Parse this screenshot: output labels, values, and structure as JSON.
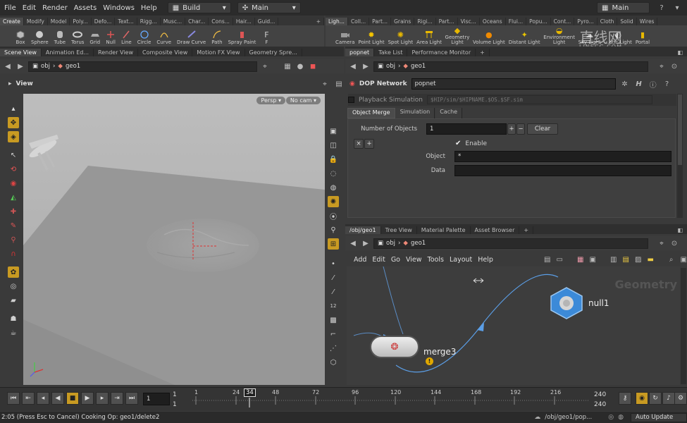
{
  "menu": [
    "File",
    "Edit",
    "Render",
    "Assets",
    "Windows",
    "Help"
  ],
  "desktop": "Build",
  "context": "Main",
  "context_right": "Main",
  "shelf_left": {
    "tabs": [
      "Create",
      "Modify",
      "Model",
      "Poly...",
      "Defo...",
      "Text...",
      "Rigg...",
      "Musc...",
      "Char...",
      "Cons...",
      "Hair...",
      "Guid..."
    ],
    "tools": [
      {
        "label": "Box",
        "icon": "cube-icon"
      },
      {
        "label": "Sphere",
        "icon": "sphere-icon"
      },
      {
        "label": "Tube",
        "icon": "tube-icon"
      },
      {
        "label": "Torus",
        "icon": "torus-icon"
      },
      {
        "label": "Grid",
        "icon": "grid-icon"
      },
      {
        "label": "Null",
        "icon": "null-icon"
      },
      {
        "label": "Line",
        "icon": "line-icon"
      },
      {
        "label": "Circle",
        "icon": "circle-icon"
      },
      {
        "label": "Curve",
        "icon": "curve-icon"
      },
      {
        "label": "Draw Curve",
        "icon": "draw-curve-icon"
      },
      {
        "label": "Path",
        "icon": "path-icon"
      },
      {
        "label": "Spray Paint",
        "icon": "spray-icon"
      },
      {
        "label": "F",
        "icon": "font-icon"
      }
    ]
  },
  "shelf_right": {
    "tabs": [
      "Ligh...",
      "Coll...",
      "Part...",
      "Grains",
      "Rigi...",
      "Part...",
      "Visc...",
      "Oceans",
      "Flui...",
      "Popu...",
      "Cont...",
      "Pyro...",
      "Cloth",
      "Solid",
      "Wires"
    ],
    "tools": [
      {
        "label": "Camera",
        "icon": "camera-icon"
      },
      {
        "label": "Point Light",
        "icon": "point-light-icon"
      },
      {
        "label": "Spot Light",
        "icon": "spot-light-icon"
      },
      {
        "label": "Area Light",
        "icon": "area-light-icon"
      },
      {
        "label": "Geometry Light",
        "icon": "geometry-light-icon"
      },
      {
        "label": "Volume Light",
        "icon": "volume-light-icon"
      },
      {
        "label": "Distant Light",
        "icon": "distant-light-icon"
      },
      {
        "label": "Environment Light",
        "icon": "environment-light-icon"
      },
      {
        "label": "Sky Light",
        "icon": "sky-light-icon"
      },
      {
        "label": "...atic Light",
        "icon": "caustic-light-icon"
      },
      {
        "label": "Portal",
        "icon": "portal-icon"
      }
    ]
  },
  "watermark": {
    "cn": "直线网",
    "en": "LINECG.COM"
  },
  "viewer": {
    "tabs": [
      "Scene View",
      "Animation Ed...",
      "Render View",
      "Composite View",
      "Motion FX View",
      "Geometry Spre..."
    ],
    "path": [
      "obj",
      "geo1"
    ],
    "title": "View",
    "persp": "Persp",
    "cam": "No cam"
  },
  "params": {
    "tabs": [
      "popnet",
      "Take List",
      "Performance Monitor"
    ],
    "path": [
      "obj",
      "geo1"
    ],
    "node_type": "DOP Network",
    "node_name": "popnet",
    "playback_label": "Playback Simulation",
    "file_path": "$HIP/sim/$HIPNAME.$OS.$SF.sim",
    "sub_tabs": [
      "Object Merge",
      "Simulation",
      "Cache"
    ],
    "num_objects_label": "Number of Objects",
    "num_objects": "1",
    "clear_label": "Clear",
    "enable_label": "Enable",
    "object_label": "Object",
    "object_value": "*",
    "data_label": "Data",
    "data_value": ""
  },
  "network": {
    "tabs": [
      "/obj/geo1",
      "Tree View",
      "Material Palette",
      "Asset Browser"
    ],
    "path": [
      "obj",
      "geo1"
    ],
    "menu": [
      "Add",
      "Edit",
      "Go",
      "View",
      "Tools",
      "Layout",
      "Help"
    ],
    "context_label": "Geometry",
    "nodes": {
      "merge": "merge3",
      "null": "null1"
    }
  },
  "timeline": {
    "frame": "1",
    "start": "1",
    "start2": "1",
    "current": "34",
    "end": "240",
    "end2": "240",
    "ticks": [
      "1",
      "24",
      "48",
      "72",
      "96",
      "120",
      "144",
      "168",
      "192",
      "216"
    ]
  },
  "status": {
    "message": "2:05 (Press Esc to Cancel) Cooking Op: geo1/delete2",
    "path": "/obj/geo1/pop...",
    "update": "Auto Update"
  },
  "colors": {
    "accent": "#c89a22",
    "link": "#5b9ee6",
    "panel": "#3a3a3a"
  }
}
